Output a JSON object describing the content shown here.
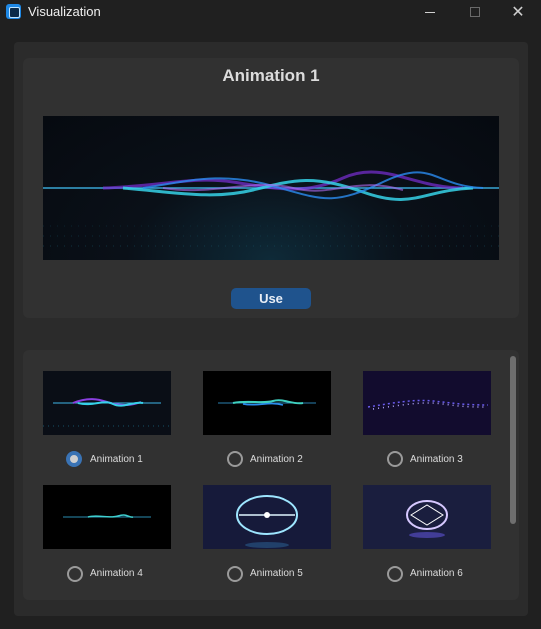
{
  "window": {
    "title": "Visualization"
  },
  "preview": {
    "title": "Animation 1",
    "use_label": "Use"
  },
  "animations": [
    {
      "label": "Animation 1",
      "selected": true
    },
    {
      "label": "Animation 2",
      "selected": false
    },
    {
      "label": "Animation 3",
      "selected": false
    },
    {
      "label": "Animation 4",
      "selected": false
    },
    {
      "label": "Animation 5",
      "selected": false
    },
    {
      "label": "Animation 6",
      "selected": false
    }
  ],
  "colors": {
    "accent": "#1f538d",
    "radio_selected": "#3a73b4",
    "panel": "#313131",
    "background": "#202020"
  },
  "icons": {
    "app": "app-icon",
    "minimize": "minimize-icon",
    "maximize": "maximize-icon",
    "close": "close-icon"
  }
}
